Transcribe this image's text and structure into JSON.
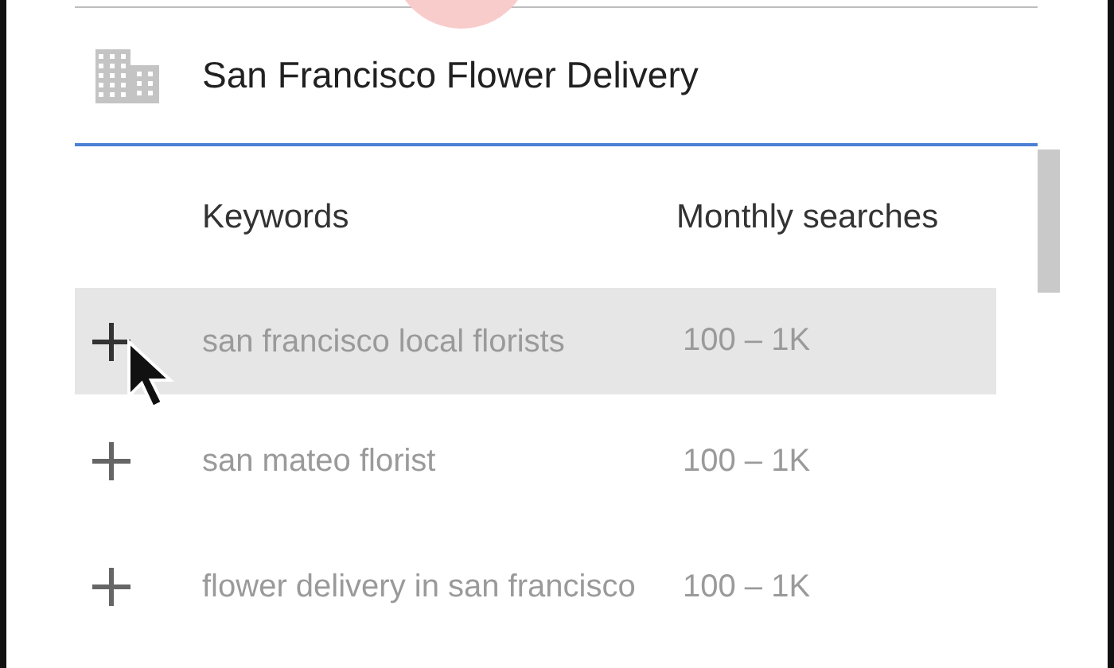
{
  "search": {
    "value": "San Francisco Flower Delivery"
  },
  "table": {
    "columns": [
      "Keywords",
      "Monthly searches"
    ],
    "rows": [
      {
        "keyword": "san francisco local florists",
        "searches": "100 – 1K",
        "selected": true
      },
      {
        "keyword": "san mateo florist",
        "searches": "100 – 1K",
        "selected": false
      },
      {
        "keyword": "flower delivery in san francisco",
        "searches": "100 – 1K",
        "selected": false
      }
    ]
  }
}
